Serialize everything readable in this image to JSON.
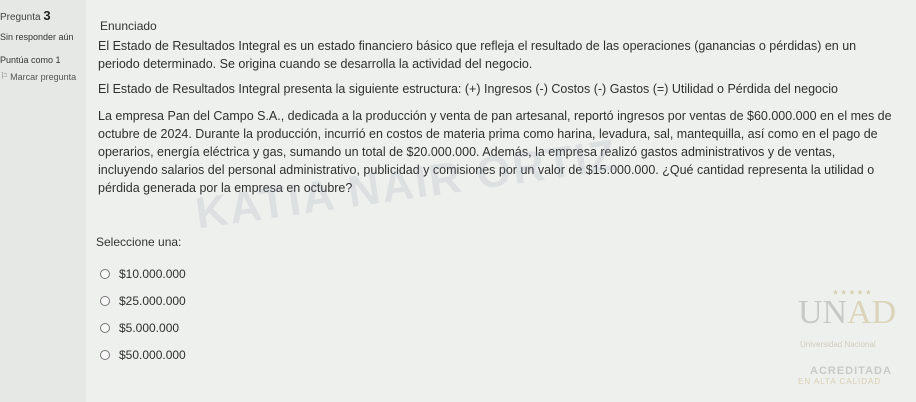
{
  "question": {
    "label": "Pregunta",
    "number": "3",
    "status": "Sin responder aún",
    "points": "Puntúa como 1",
    "flag_label": "Marcar pregunta"
  },
  "content": {
    "heading": "Enunciado",
    "paragraph1": "El Estado de Resultados Integral es un estado financiero básico que refleja el resultado de las operaciones (ganancias o pérdidas) en un periodo determinado. Se origina cuando se desarrolla la actividad del negocio.",
    "paragraph2": "El Estado de Resultados Integral presenta la siguiente estructura: (+) Ingresos (-) Costos (-) Gastos (=) Utilidad o Pérdida del negocio",
    "paragraph3": "La empresa Pan del Campo S.A., dedicada a la producción y venta de pan artesanal, reportó ingresos por ventas de $60.000.000 en el mes de octubre de 2024. Durante la producción, incurrió en costos de materia prima como harina, levadura, sal, mantequilla, así como en el pago de operarios, energía eléctrica y gas, sumando un total de $20.000.000. Además, la empresa realizó gastos administrativos y de ventas, incluyendo salarios del personal administrativo, publicidad y comisiones por un valor de $15.000.000. ¿Qué cantidad representa la utilidad o pérdida generada por la empresa en octubre?",
    "watermark": "KATIA NAIR ORTIZ",
    "prompt": "Seleccione una:",
    "options": [
      "$10.000.000",
      "$25.000.000",
      "$5.000.000",
      "$50.000.000"
    ]
  },
  "logo": {
    "main_un": "UN",
    "main_ad": "AD",
    "subtitle": "Universidad Nacional",
    "acreditada": "ACREDITADA",
    "calidad": "EN ALTA CALIDAD"
  }
}
